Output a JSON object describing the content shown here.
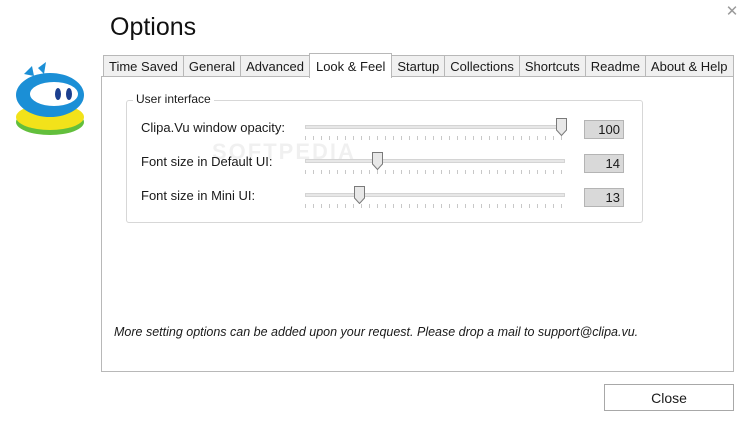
{
  "window": {
    "title": "Options",
    "close_glyph": "✕"
  },
  "brand": {
    "logo_icon": "clipa-vu-logo",
    "colors": {
      "blue": "#1b8fd6",
      "green": "#62bf3c",
      "yellow": "#f2e21a",
      "white": "#ffffff"
    }
  },
  "tabs": [
    {
      "label": "Time Saved"
    },
    {
      "label": "General"
    },
    {
      "label": "Advanced"
    },
    {
      "label": "Look & Feel",
      "active": true
    },
    {
      "label": "Startup"
    },
    {
      "label": "Collections"
    },
    {
      "label": "Shortcuts"
    },
    {
      "label": "Readme"
    },
    {
      "label": "About & Help"
    }
  ],
  "look_and_feel": {
    "group_title": "User interface",
    "settings": [
      {
        "label": "Clipa.Vu window opacity:",
        "value": "100",
        "fraction": 1.0
      },
      {
        "label": "Font size in Default UI:",
        "value": "14",
        "fraction": 0.28
      },
      {
        "label": "Font size in Mini UI:",
        "value": "13",
        "fraction": 0.21
      }
    ],
    "note": "More setting options can be added upon your request. Please drop a mail to support@clipa.vu."
  },
  "watermark": "SOFTPEDIA",
  "footer": {
    "close_label": "Close"
  }
}
